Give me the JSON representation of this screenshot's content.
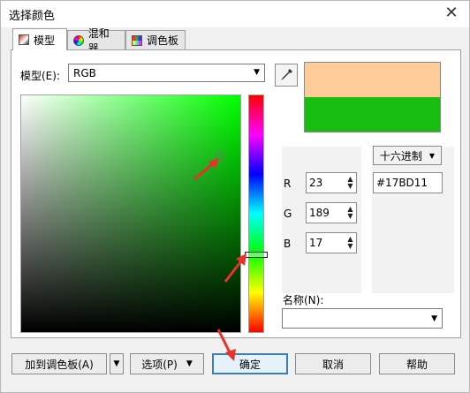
{
  "window": {
    "title": "选择颜色",
    "close_glyph": "✕"
  },
  "tabs": [
    {
      "label": "模型",
      "icon": "model-icon"
    },
    {
      "label": "混和器",
      "icon": "mixer-icon"
    },
    {
      "label": "调色板",
      "icon": "palette-icon"
    }
  ],
  "model": {
    "label": "模型(E):",
    "value": "RGB"
  },
  "preview": {
    "old_color": "#ffcc99",
    "new_color": "#17bd11"
  },
  "values": {
    "r": {
      "label": "R",
      "value": "23"
    },
    "g": {
      "label": "G",
      "value": "189"
    },
    "b": {
      "label": "B",
      "value": "17"
    }
  },
  "hex": {
    "mode": "十六进制",
    "value": "#17BD11"
  },
  "name": {
    "label": "名称(N):",
    "value": ""
  },
  "buttons": {
    "add_palette": "加到调色板(A)",
    "options": "选项(P)",
    "ok": "确定",
    "cancel": "取消",
    "help": "帮助"
  },
  "colors": {
    "hue": "#00ff00",
    "primary_border": "#3c7fb1",
    "annotation": "#e8322a"
  }
}
